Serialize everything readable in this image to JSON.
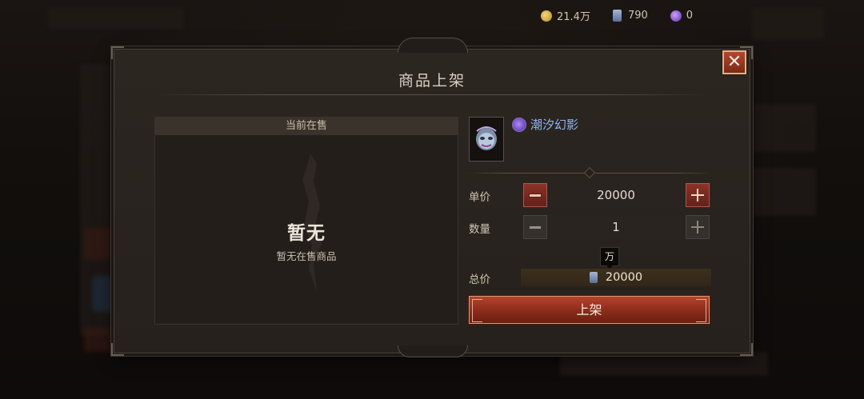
{
  "currencies": [
    {
      "icon": "gold-coin-icon",
      "value": "21.4万"
    },
    {
      "icon": "ticket-icon",
      "value": "790"
    },
    {
      "icon": "purple-orb-icon",
      "value": "0"
    }
  ],
  "dialog": {
    "title": "商品上架",
    "close_symbol": "✕"
  },
  "current_sale": {
    "header": "当前在售",
    "empty_title": "暂无",
    "empty_subtitle": "暂无在售商品"
  },
  "item": {
    "name": "潮汐幻影",
    "rarity_color": "#7a4ed6",
    "name_color": "#8fb3f0"
  },
  "form": {
    "unit_price_label": "单价",
    "unit_price_value": "20000",
    "quantity_label": "数量",
    "quantity_value": "1",
    "unit_hint": "万",
    "total_label": "总价",
    "total_value": "20000",
    "submit_label": "上架"
  },
  "colors": {
    "accent_red": "#8a2b1a",
    "panel_bg": "#26211d",
    "text_light": "#d8d0c2"
  }
}
